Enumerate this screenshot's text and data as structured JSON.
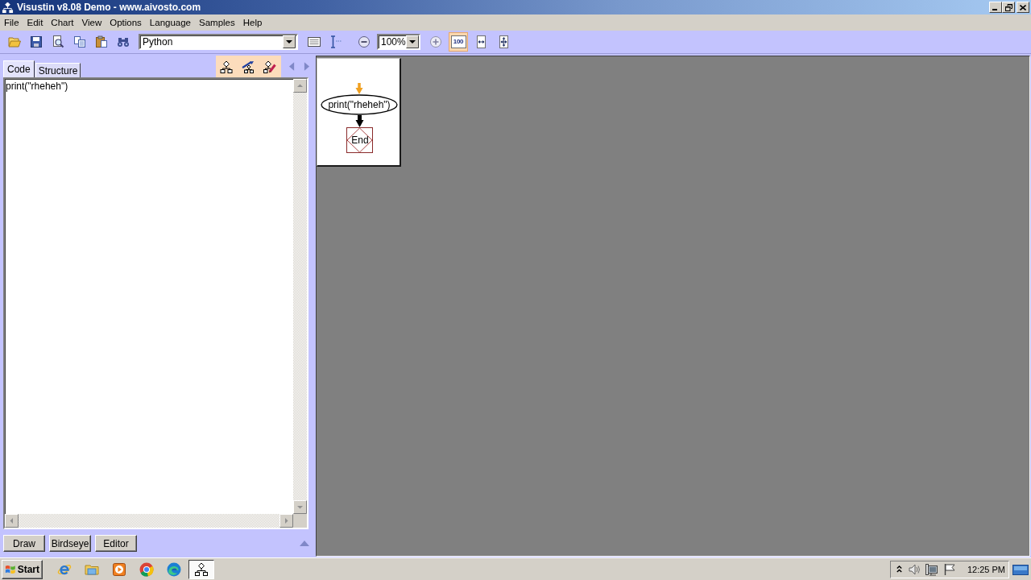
{
  "window": {
    "title": "Visustin v8.08 Demo - www.aivosto.com"
  },
  "menu": [
    "File",
    "Edit",
    "Chart",
    "View",
    "Options",
    "Language",
    "Samples",
    "Help"
  ],
  "toolbar": {
    "language": "Python",
    "zoom": "100%",
    "zoom_modes": [
      {
        "label": "100",
        "selected": true
      },
      {
        "selected": false
      },
      {
        "selected": false
      }
    ]
  },
  "tabs": [
    {
      "label": "Code",
      "selected": true
    },
    {
      "label": "Structure",
      "selected": false
    }
  ],
  "code": [
    "print(\"rheheh\")"
  ],
  "flowchart": {
    "nodes": [
      {
        "kind": "process",
        "label": "print(\"rheheh\")"
      },
      {
        "kind": "end",
        "label": "End"
      }
    ]
  },
  "buttons": [
    "Draw",
    "Birdseye",
    "Editor"
  ],
  "taskbar": {
    "start": "Start",
    "apps": [
      {
        "selected": false
      },
      {
        "selected": false
      },
      {
        "selected": false
      },
      {
        "selected": false
      },
      {
        "selected": false
      },
      {
        "selected": true
      }
    ],
    "clock": "12:25 PM"
  }
}
